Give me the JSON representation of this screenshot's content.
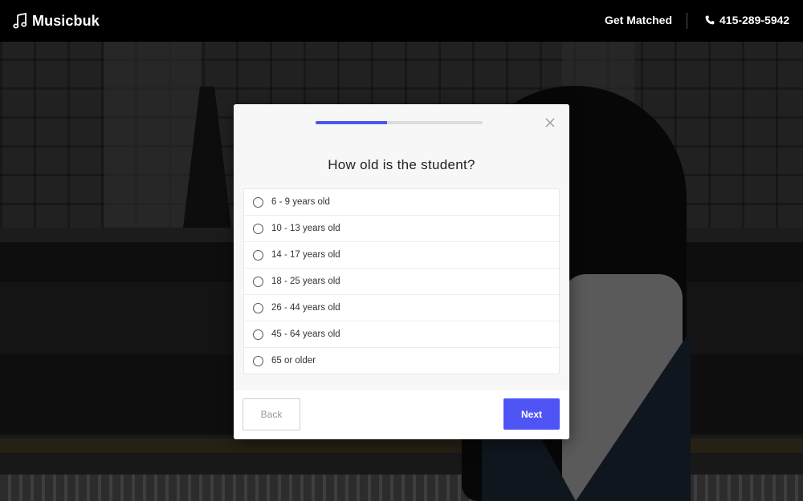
{
  "header": {
    "brand": "Musicbuk",
    "brand_icon": "music-note-icon",
    "get_matched": "Get Matched",
    "phone": "415-289-5942",
    "phone_icon": "phone-icon"
  },
  "modal": {
    "progress_percent": 43,
    "close_icon": "close-icon",
    "question": "How old is the student?",
    "options": [
      "6 - 9 years old",
      "10 - 13 years old",
      "14 - 17 years old",
      "18 - 25 years old",
      "26 - 44 years old",
      "45 - 64 years old",
      "65 or older"
    ],
    "back_label": "Back",
    "next_label": "Next"
  },
  "colors": {
    "accent": "#4f55f5",
    "topbar": "#000000"
  }
}
